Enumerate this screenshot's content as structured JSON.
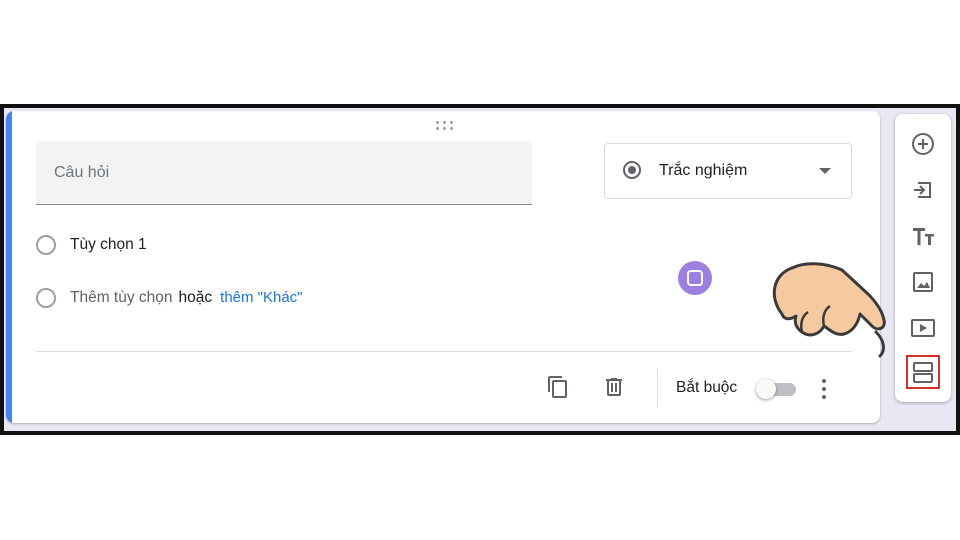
{
  "question": {
    "placeholder": "Câu hỏi"
  },
  "question_type": {
    "selected": "Trắc nghiệm",
    "icon": "radio-button-icon"
  },
  "options": {
    "option1": "Tùy chọn 1",
    "add_option": "Thêm tùy chọn",
    "or_text": "hoặc",
    "add_other": "thêm \"Khác\""
  },
  "footer": {
    "required_label": "Bắt buộc",
    "required": false,
    "icons": [
      "duplicate-icon",
      "delete-icon",
      "more-vert-icon"
    ]
  },
  "toolbar": {
    "items": [
      "add-question-icon",
      "import-questions-icon",
      "add-title-icon",
      "add-image-icon",
      "add-video-icon",
      "add-section-icon"
    ],
    "selected": "add-section-icon"
  },
  "colors": {
    "accent": "#4285f4",
    "link": "#1a73e8",
    "highlight_box": "#d32f2f",
    "background": "#eae6f4"
  }
}
